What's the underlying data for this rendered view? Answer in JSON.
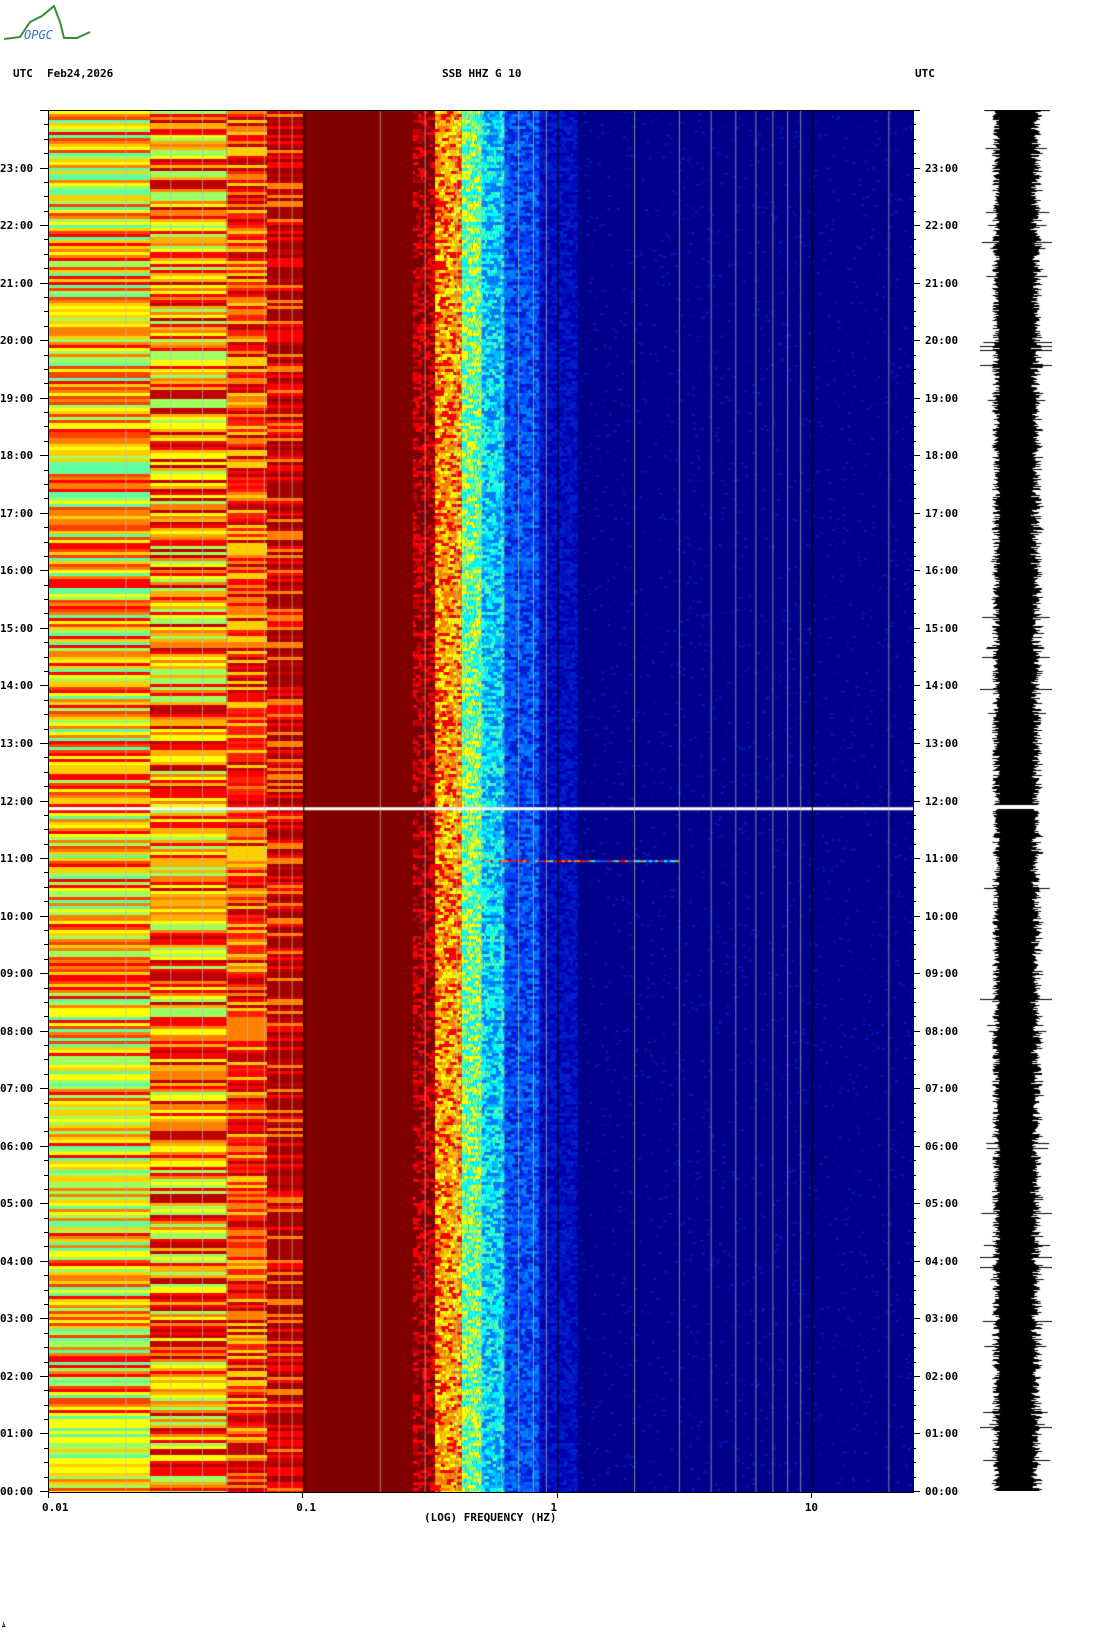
{
  "logo_text": "OPGC",
  "header": {
    "left_tz": "UTC",
    "date": "Feb24,2026",
    "title": "SSB HHZ G 10",
    "right_tz": "UTC"
  },
  "footer_mark": "ﾑ",
  "chart_data": {
    "type": "heatmap",
    "title": "SSB HHZ G 10",
    "date": "Feb24,2026",
    "xlabel": "(LOG) FREQUENCY (HZ)",
    "xscale": "log",
    "xlim": [
      0.01,
      25
    ],
    "x_ticks": [
      {
        "value": 0.01,
        "label": "0.01"
      },
      {
        "value": 0.1,
        "label": "0.1"
      },
      {
        "value": 1,
        "label": "1"
      },
      {
        "value": 10,
        "label": "10"
      }
    ],
    "ylabel": "UTC",
    "ylim_hours": [
      0,
      24
    ],
    "y_ticks": [
      "00:00",
      "01:00",
      "02:00",
      "03:00",
      "04:00",
      "05:00",
      "06:00",
      "07:00",
      "08:00",
      "09:00",
      "10:00",
      "11:00",
      "12:00",
      "13:00",
      "14:00",
      "15:00",
      "16:00",
      "17:00",
      "18:00",
      "19:00",
      "20:00",
      "21:00",
      "22:00",
      "23:00"
    ],
    "colormap": [
      "#00008b",
      "#0000ff",
      "#00ffff",
      "#7fff7f",
      "#ffff00",
      "#ff8000",
      "#ff0000",
      "#800000"
    ],
    "features": [
      {
        "type": "data-gap",
        "hour": 11.9
      },
      {
        "type": "transient",
        "hour": 10.98,
        "freq_range": [
          0.5,
          3
        ]
      }
    ],
    "has_seismogram_trace": true
  }
}
